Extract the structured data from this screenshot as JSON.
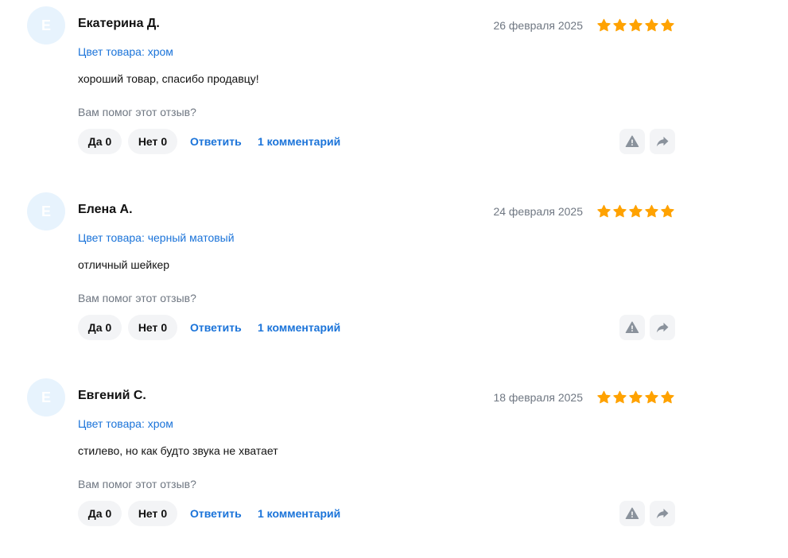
{
  "reviews": [
    {
      "initial": "Е",
      "author": "Екатерина Д.",
      "date": "26 февраля 2025",
      "rating": 5,
      "variant": "Цвет товара: хром",
      "text": "хороший товар, спасибо продавцу!",
      "helpful_question": "Вам помог этот отзыв?",
      "yes_label": "Да",
      "yes_count": "0",
      "no_label": "Нет",
      "no_count": "0",
      "reply_label": "Ответить",
      "comments_label": "1 комментарий"
    },
    {
      "initial": "Е",
      "author": "Елена А.",
      "date": "24 февраля 2025",
      "rating": 5,
      "variant": "Цвет товара: черный матовый",
      "text": "отличный шейкер",
      "helpful_question": "Вам помог этот отзыв?",
      "yes_label": "Да",
      "yes_count": "0",
      "no_label": "Нет",
      "no_count": "0",
      "reply_label": "Ответить",
      "comments_label": "1 комментарий"
    },
    {
      "initial": "Е",
      "author": "Евгений С.",
      "date": "18 февраля 2025",
      "rating": 5,
      "variant": "Цвет товара: хром",
      "text": "стилево, но как будто звука не хватает",
      "helpful_question": "Вам помог этот отзыв?",
      "yes_label": "Да",
      "yes_count": "0",
      "no_label": "Нет",
      "no_count": "0",
      "reply_label": "Ответить",
      "comments_label": "1 комментарий"
    }
  ],
  "colors": {
    "star": "#ffa200",
    "link": "#1a73d9",
    "avatar_bg": "#e7f3fd",
    "button_bg": "#f3f4f6",
    "icon": "#8a929c"
  },
  "icons": {
    "rating": "star-icon",
    "report": "warning-triangle-icon",
    "share": "share-arrow-icon"
  }
}
